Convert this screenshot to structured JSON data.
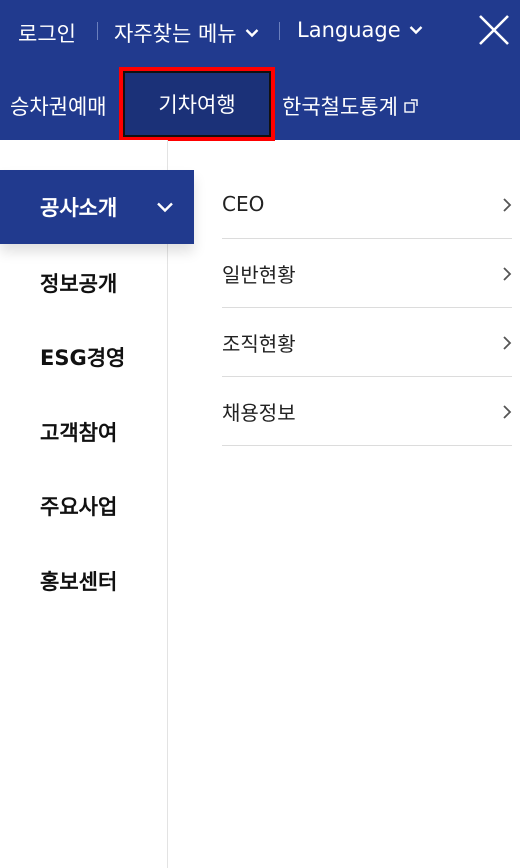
{
  "topbar": {
    "login_label": "로그인",
    "faq_label": "자주찾는 메뉴",
    "language_label": "Language",
    "background_color": "#213a8e"
  },
  "tabs": [
    {
      "label": "승차권예매"
    },
    {
      "label": "기차여행",
      "highlighted": true,
      "highlight_color": "#ff0000"
    },
    {
      "label": "한국철도통계",
      "external": true
    }
  ],
  "leftnav": {
    "items": [
      {
        "label": "공사소개",
        "active": true
      },
      {
        "label": "정보공개"
      },
      {
        "label": "ESG경영"
      },
      {
        "label": "고객참여"
      },
      {
        "label": "주요사업"
      },
      {
        "label": "홍보센터"
      }
    ],
    "active_color": "#213a8e"
  },
  "submenu": {
    "items": [
      {
        "label": "CEO"
      },
      {
        "label": "일반현황"
      },
      {
        "label": "조직현황"
      },
      {
        "label": "채용정보"
      }
    ]
  },
  "icons": {
    "close": "close-icon",
    "chevron_down": "chevron-down-icon",
    "chevron_right": "chevron-right-icon",
    "external_link": "external-link-icon"
  }
}
